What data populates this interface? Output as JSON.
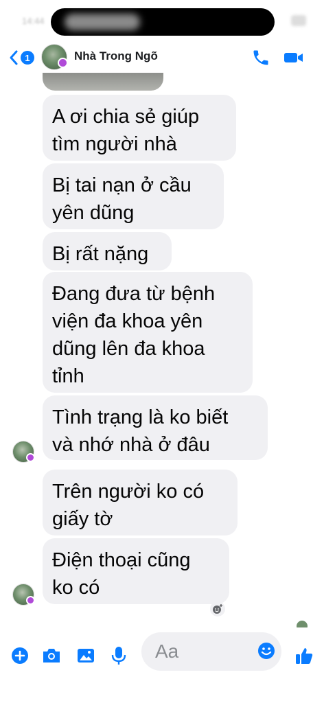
{
  "status_bar": {
    "time": "14:44"
  },
  "header": {
    "back_badge": "1",
    "title": "Nhà Trong Ngõ"
  },
  "messages": [
    {
      "text": "A ơi chia sẻ giúp\ntìm người nhà"
    },
    {
      "text": "Bị tai nạn ở cầu\nyên dũng"
    },
    {
      "text": "Bị rất nặng"
    },
    {
      "text": "Đang đưa từ bệnh\nviện đa khoa yên\ndũng lên đa khoa\ntỉnh"
    },
    {
      "text": "Tình trạng là ko biết\nvà nhớ nhà ở đâu"
    },
    {
      "text": "Trên người ko có\ngiấy tờ"
    },
    {
      "text": "Điện thoại cũng\nko có"
    }
  ],
  "composer": {
    "placeholder": "Aa"
  },
  "colors": {
    "accent": "#0a7cff",
    "bubble": "#f0f0f3",
    "online_dot": "#b04ad8"
  },
  "icons": [
    "chevron-left-icon",
    "phone-icon",
    "video-camera-icon",
    "plus-circle-icon",
    "camera-icon",
    "image-icon",
    "microphone-icon",
    "emoji-icon",
    "thumbs-up-icon",
    "add-reaction-icon"
  ]
}
